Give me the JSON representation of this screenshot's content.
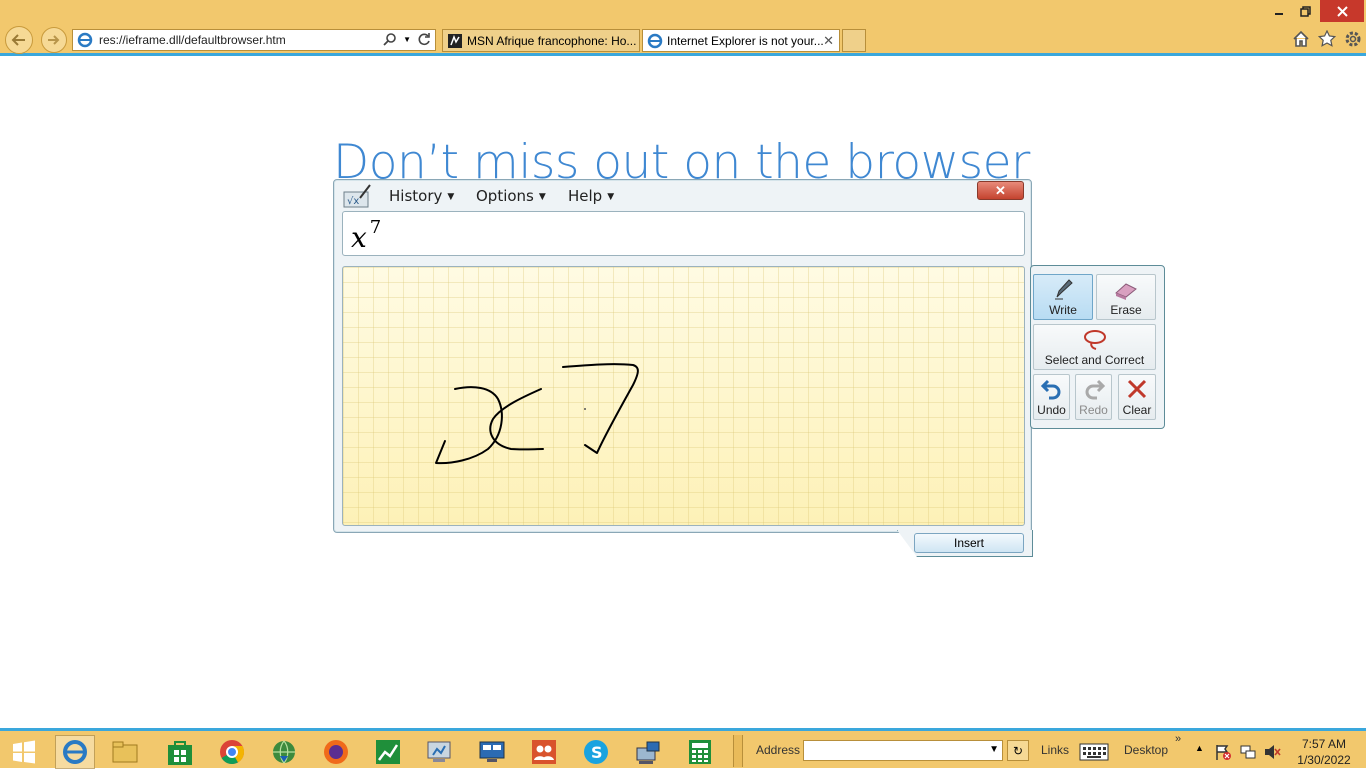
{
  "browser": {
    "url": "res://ieframe.dll/defaultbrowser.htm",
    "tabs": [
      {
        "label": "MSN Afrique francophone: Ho...",
        "active": false
      },
      {
        "label": "Internet Explorer is not your...",
        "active": true
      }
    ]
  },
  "page": {
    "title": "Don’t miss out on the browser"
  },
  "math_panel": {
    "menus": {
      "history": "History",
      "options": "Options",
      "help": "Help"
    },
    "preview_base": "x",
    "preview_exponent": "7",
    "tools": {
      "write": "Write",
      "erase": "Erase",
      "select": "Select and Correct",
      "undo": "Undo",
      "redo": "Redo",
      "clear": "Clear"
    },
    "insert": "Insert"
  },
  "taskbar": {
    "address_label": "Address",
    "links_label": "Links",
    "desktop_label": "Desktop",
    "time": "7:57 AM",
    "date": "1/30/2022"
  },
  "colors": {
    "chrome": "#f2c86d",
    "accent": "#3aa7dc",
    "title": "#3f88d2"
  }
}
